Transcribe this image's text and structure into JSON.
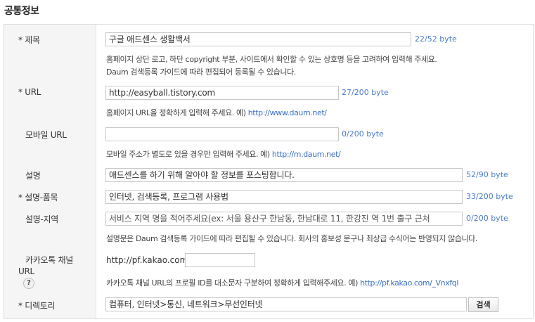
{
  "section_title": "공통정보",
  "title": {
    "label": "* 제목",
    "value": "구글 애드센스 생활백서",
    "count": "22/52 byte",
    "help1": "홈페이지 상단 로고, 하단 copyright 부분, 사이트에서 확인할 수 있는 상호명 등을 고려하여 입력해 주세요.",
    "help2": "Daum 검색등록 가이드에 따라 편집되어 등록될 수 있습니다."
  },
  "url": {
    "label": "* URL",
    "value": "http://easyball.tistory.com",
    "count": "27/200 byte",
    "help_text": "홈페이지 URL을 정확하게 입력해 주세요. 예)",
    "help_link": "http://www.daum.net/"
  },
  "mobile_url": {
    "label": "모바일 URL",
    "value": "",
    "count": "0/200 byte",
    "help_text": "모바일 주소가 별도로 있을 경우만 입력해 주세요. 예)",
    "help_link": "http://m.daum.net/"
  },
  "description": {
    "label": "설명",
    "value": "애드센스를 하기 위해 알아야 할 정보를 포스팅합니다.",
    "count": "52/90 byte"
  },
  "desc_product": {
    "label": "* 설명-품목",
    "value": "인터넷, 검색등록, 프로그램 사용법",
    "count": "33/200 byte"
  },
  "desc_region": {
    "label": "설명-지역",
    "placeholder": "서비스 지역 명을 적어주세요(ex: 서울  용산구 한남동, 한남대로 11, 한강진 역 1번 출구 근처",
    "count": "0/200 byte",
    "help": "설명문은 Daum 검색등록 가이드에 따라 편집될 수 있습니다. 회사의 홍보성 문구나 최상급 수식어는 반영되지 않습니다."
  },
  "kakao": {
    "label1": "카카오톡 채널",
    "label2": "URL",
    "help_icon": "?",
    "prefix": "http://pf.kakao.com/",
    "value": "",
    "help_text": "카카오톡 채널 URL의 프로필 ID를 대소문자 구분하여 정확하게 입력해주세요. 예)",
    "help_link": "http://pf.kakao.com/_Vnxfql"
  },
  "directory": {
    "label": "* 디렉토리",
    "value": "컴퓨터, 인터넷>통신, 네트워크>무선인터넷",
    "button": "검색"
  }
}
